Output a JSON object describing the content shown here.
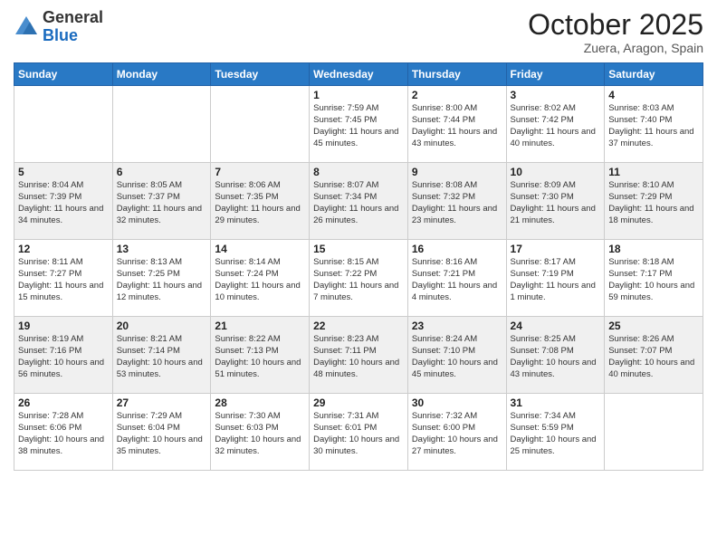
{
  "header": {
    "logo_general": "General",
    "logo_blue": "Blue",
    "month_title": "October 2025",
    "subtitle": "Zuera, Aragon, Spain"
  },
  "days_of_week": [
    "Sunday",
    "Monday",
    "Tuesday",
    "Wednesday",
    "Thursday",
    "Friday",
    "Saturday"
  ],
  "weeks": [
    [
      {
        "day": "",
        "info": ""
      },
      {
        "day": "",
        "info": ""
      },
      {
        "day": "",
        "info": ""
      },
      {
        "day": "1",
        "info": "Sunrise: 7:59 AM\nSunset: 7:45 PM\nDaylight: 11 hours and 45 minutes."
      },
      {
        "day": "2",
        "info": "Sunrise: 8:00 AM\nSunset: 7:44 PM\nDaylight: 11 hours and 43 minutes."
      },
      {
        "day": "3",
        "info": "Sunrise: 8:02 AM\nSunset: 7:42 PM\nDaylight: 11 hours and 40 minutes."
      },
      {
        "day": "4",
        "info": "Sunrise: 8:03 AM\nSunset: 7:40 PM\nDaylight: 11 hours and 37 minutes."
      }
    ],
    [
      {
        "day": "5",
        "info": "Sunrise: 8:04 AM\nSunset: 7:39 PM\nDaylight: 11 hours and 34 minutes."
      },
      {
        "day": "6",
        "info": "Sunrise: 8:05 AM\nSunset: 7:37 PM\nDaylight: 11 hours and 32 minutes."
      },
      {
        "day": "7",
        "info": "Sunrise: 8:06 AM\nSunset: 7:35 PM\nDaylight: 11 hours and 29 minutes."
      },
      {
        "day": "8",
        "info": "Sunrise: 8:07 AM\nSunset: 7:34 PM\nDaylight: 11 hours and 26 minutes."
      },
      {
        "day": "9",
        "info": "Sunrise: 8:08 AM\nSunset: 7:32 PM\nDaylight: 11 hours and 23 minutes."
      },
      {
        "day": "10",
        "info": "Sunrise: 8:09 AM\nSunset: 7:30 PM\nDaylight: 11 hours and 21 minutes."
      },
      {
        "day": "11",
        "info": "Sunrise: 8:10 AM\nSunset: 7:29 PM\nDaylight: 11 hours and 18 minutes."
      }
    ],
    [
      {
        "day": "12",
        "info": "Sunrise: 8:11 AM\nSunset: 7:27 PM\nDaylight: 11 hours and 15 minutes."
      },
      {
        "day": "13",
        "info": "Sunrise: 8:13 AM\nSunset: 7:25 PM\nDaylight: 11 hours and 12 minutes."
      },
      {
        "day": "14",
        "info": "Sunrise: 8:14 AM\nSunset: 7:24 PM\nDaylight: 11 hours and 10 minutes."
      },
      {
        "day": "15",
        "info": "Sunrise: 8:15 AM\nSunset: 7:22 PM\nDaylight: 11 hours and 7 minutes."
      },
      {
        "day": "16",
        "info": "Sunrise: 8:16 AM\nSunset: 7:21 PM\nDaylight: 11 hours and 4 minutes."
      },
      {
        "day": "17",
        "info": "Sunrise: 8:17 AM\nSunset: 7:19 PM\nDaylight: 11 hours and 1 minute."
      },
      {
        "day": "18",
        "info": "Sunrise: 8:18 AM\nSunset: 7:17 PM\nDaylight: 10 hours and 59 minutes."
      }
    ],
    [
      {
        "day": "19",
        "info": "Sunrise: 8:19 AM\nSunset: 7:16 PM\nDaylight: 10 hours and 56 minutes."
      },
      {
        "day": "20",
        "info": "Sunrise: 8:21 AM\nSunset: 7:14 PM\nDaylight: 10 hours and 53 minutes."
      },
      {
        "day": "21",
        "info": "Sunrise: 8:22 AM\nSunset: 7:13 PM\nDaylight: 10 hours and 51 minutes."
      },
      {
        "day": "22",
        "info": "Sunrise: 8:23 AM\nSunset: 7:11 PM\nDaylight: 10 hours and 48 minutes."
      },
      {
        "day": "23",
        "info": "Sunrise: 8:24 AM\nSunset: 7:10 PM\nDaylight: 10 hours and 45 minutes."
      },
      {
        "day": "24",
        "info": "Sunrise: 8:25 AM\nSunset: 7:08 PM\nDaylight: 10 hours and 43 minutes."
      },
      {
        "day": "25",
        "info": "Sunrise: 8:26 AM\nSunset: 7:07 PM\nDaylight: 10 hours and 40 minutes."
      }
    ],
    [
      {
        "day": "26",
        "info": "Sunrise: 7:28 AM\nSunset: 6:06 PM\nDaylight: 10 hours and 38 minutes."
      },
      {
        "day": "27",
        "info": "Sunrise: 7:29 AM\nSunset: 6:04 PM\nDaylight: 10 hours and 35 minutes."
      },
      {
        "day": "28",
        "info": "Sunrise: 7:30 AM\nSunset: 6:03 PM\nDaylight: 10 hours and 32 minutes."
      },
      {
        "day": "29",
        "info": "Sunrise: 7:31 AM\nSunset: 6:01 PM\nDaylight: 10 hours and 30 minutes."
      },
      {
        "day": "30",
        "info": "Sunrise: 7:32 AM\nSunset: 6:00 PM\nDaylight: 10 hours and 27 minutes."
      },
      {
        "day": "31",
        "info": "Sunrise: 7:34 AM\nSunset: 5:59 PM\nDaylight: 10 hours and 25 minutes."
      },
      {
        "day": "",
        "info": ""
      }
    ]
  ]
}
